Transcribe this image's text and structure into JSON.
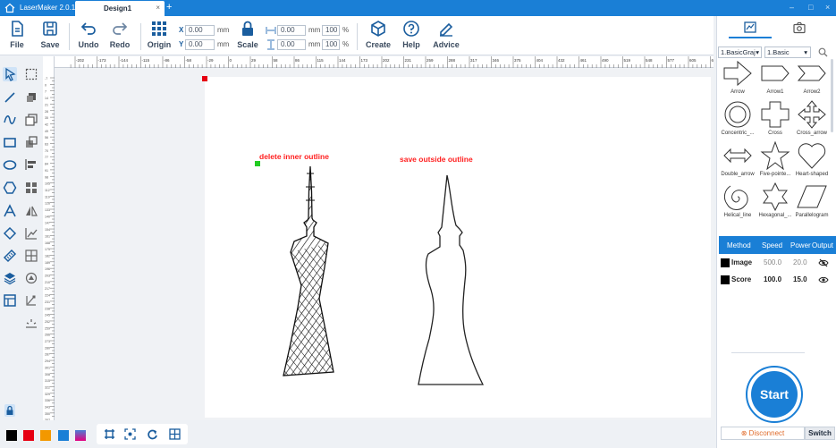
{
  "app": {
    "name": "LaserMaker 2.0.15"
  },
  "tabs": [
    {
      "label": "Design1",
      "close": "×"
    }
  ],
  "tab_add": "+",
  "window_controls": {
    "minimize": "–",
    "maximize": "□",
    "close": "×"
  },
  "toolbar": {
    "file": "File",
    "save": "Save",
    "undo": "Undo",
    "redo": "Redo",
    "origin": "Origin",
    "scale": "Scale",
    "create": "Create",
    "help": "Help",
    "advice": "Advice",
    "x_label": "X",
    "y_label": "Y",
    "x_value": "0.00",
    "y_value": "0.00",
    "unit": "mm",
    "width_value": "0.00",
    "height_value": "0.00",
    "width_pct": "100",
    "height_pct": "100",
    "pct": "%"
  },
  "ruler": {
    "unit": "mm",
    "top_ticks": [
      "-202",
      "-173",
      "-144",
      "-115",
      "-86",
      "-58",
      "-29",
      "0",
      "29",
      "58",
      "86",
      "115",
      "144",
      "173",
      "202",
      "231",
      "259",
      "288",
      "317",
      "346",
      "375",
      "404",
      "432",
      "461",
      "490",
      "519",
      "548",
      "577",
      "605",
      "634",
      "663"
    ],
    "left_ticks": [
      "-7",
      "0",
      "7",
      "14",
      "21",
      "28",
      "35",
      "42",
      "49",
      "56",
      "63",
      "70",
      "77",
      "84",
      "91",
      "98",
      "105",
      "112",
      "119",
      "126",
      "133",
      "140",
      "147",
      "154",
      "161",
      "168",
      "175",
      "182",
      "189",
      "196",
      "203",
      "210",
      "217",
      "224",
      "231",
      "238",
      "245",
      "252",
      "259",
      "266",
      "273",
      "280",
      "287",
      "294",
      "301",
      "308",
      "315",
      "322",
      "329",
      "336",
      "343",
      "350",
      "357"
    ]
  },
  "canvas": {
    "annotations": [
      "delete inner outline",
      "save outside outline"
    ]
  },
  "colors": {
    "accent": "#1a7fd6",
    "annotation": "#ff1f1f",
    "swatches": [
      "#000000",
      "#e60012",
      "#f39800",
      "#1a7fd6",
      "#e4007f"
    ]
  },
  "library": {
    "category": "1.BasicGraj",
    "subcategory": "1.Basic",
    "shapes": [
      "Arrow",
      "Arrow1",
      "Arrow2",
      "Concentric_...",
      "Cross",
      "Cross_arrow",
      "Double_arrow",
      "Five-pointe...",
      "Heart-shaped",
      "Helical_line",
      "Hexagonal_...",
      "Parallelogram"
    ]
  },
  "layers": {
    "headers": [
      "Method",
      "Speed",
      "Power",
      "Output"
    ],
    "rows": [
      {
        "method": "Image",
        "speed": "500.0",
        "power": "20.0",
        "color": "#000000",
        "output_icon": "eye-hidden-icon"
      },
      {
        "method": "Score",
        "speed": "100.0",
        "power": "15.0",
        "color": "#000000",
        "output_icon": "eye-icon"
      }
    ]
  },
  "actions": {
    "start": "Start",
    "disconnect": "Disconnect",
    "switch": "Switch"
  }
}
